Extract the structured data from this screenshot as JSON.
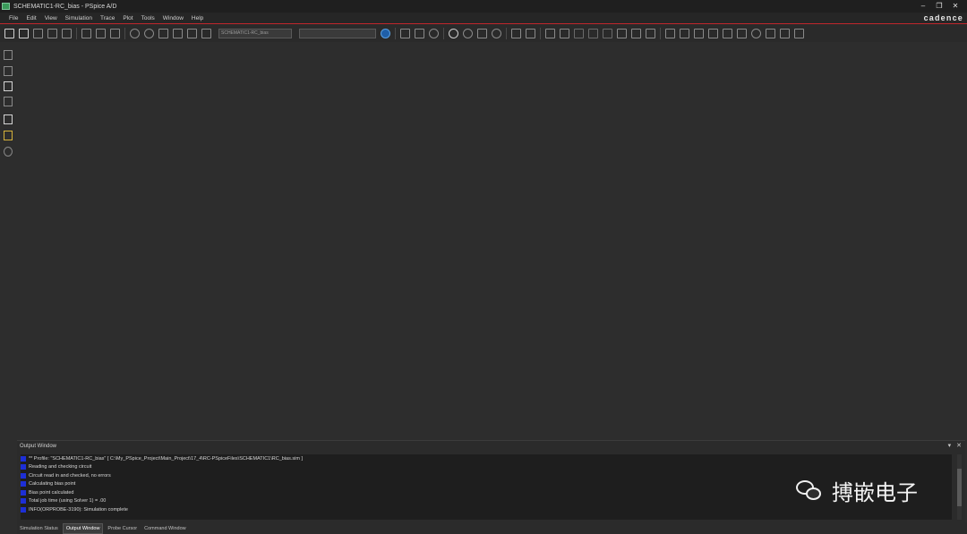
{
  "window": {
    "title": "SCHEMATIC1-RC_bias - PSpice A/D",
    "controls": [
      "–",
      "❐",
      "✕"
    ]
  },
  "menu": [
    "File",
    "Edit",
    "View",
    "Simulation",
    "Trace",
    "Plot",
    "Tools",
    "Window",
    "Help"
  ],
  "brand": "cadence",
  "toolbar": {
    "profile_combo": "SCHEMATIC1-RC_bias",
    "trace_combo": ""
  },
  "output_window": {
    "title": "Output Window",
    "controls": [
      "▾",
      "✕"
    ],
    "lines": [
      "** Profile: \"SCHEMATIC1-RC_bias\" [ C:\\My_PSpice_Project\\Main_Project\\17_4\\RC-PSpiceFiles\\SCHEMATIC1\\RC_bias.sim ]",
      "Reading and checking circuit",
      "Circuit read in and checked, no errors",
      "Calculating bias point",
      "Bias point calculated",
      "  Total job time (using Solver 1)   =        .00",
      "INFO(ORPROBE-3190): Simulation complete"
    ]
  },
  "bottom_tabs": [
    "Simulation Status",
    "Output Window",
    "Probe Cursor",
    "Command Window"
  ],
  "active_tab": "Output Window",
  "watermark": "搏嵌电子"
}
